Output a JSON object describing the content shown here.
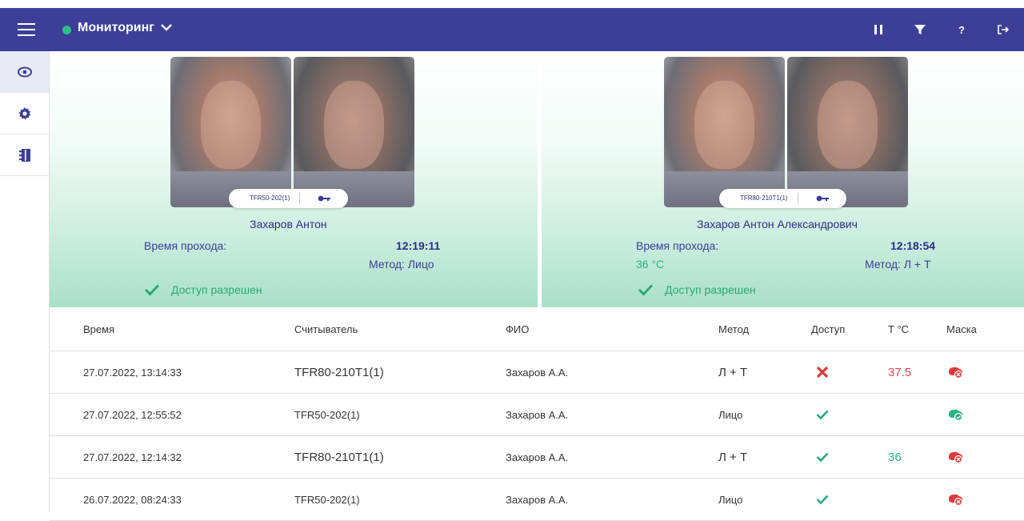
{
  "header": {
    "title": "Мониторинг",
    "status_color": "#2bbf86",
    "bg_color": "#3b3f98",
    "actions": [
      {
        "name": "pause-icon",
        "glyph": "II"
      },
      {
        "name": "filter-icon",
        "glyph": "▼"
      },
      {
        "name": "help-icon",
        "glyph": "?"
      },
      {
        "name": "logout-icon",
        "glyph": "↦"
      }
    ]
  },
  "sidebar": {
    "items": [
      {
        "name": "eye-icon",
        "active": true
      },
      {
        "name": "gear-icon",
        "active": false
      },
      {
        "name": "address-book-icon",
        "active": false
      }
    ]
  },
  "panels": [
    {
      "reader": "TFR50-202(1)",
      "person": "Захаров Антон",
      "time_label": "Время прохода:",
      "time": "12:19:11",
      "temperature": "",
      "method": "Метод: Лицо",
      "access": "Доступ разрешен"
    },
    {
      "reader": "TFR80-210T1(1)",
      "person": "Захаров Антон Александрович",
      "time_label": "Время прохода:",
      "time": "12:18:54",
      "temperature": "36 °C",
      "method": "Метод: Л + Т",
      "access": "Доступ разрешен"
    }
  ],
  "table": {
    "headers": {
      "time": "Время",
      "reader": "Считыватель",
      "fio": "ФИО",
      "method": "Метод",
      "access": "Доступ",
      "temp": "T °C",
      "mask": "Маска"
    },
    "rows": [
      {
        "time": "27.07.2022, 13:14:33",
        "reader": "TFR80-210T1(1)",
        "fio": "Захаров А.А.",
        "method": "Л + Т",
        "access": "denied",
        "temp": "37.5",
        "temp_status": "high",
        "mask": "no-mask"
      },
      {
        "time": "27.07.2022, 12:55:52",
        "reader": "TFR50-202(1)",
        "fio": "Захаров А.А.",
        "method": "Лицо",
        "access": "granted",
        "temp": "",
        "temp_status": "",
        "mask": "mask-ok"
      },
      {
        "time": "27.07.2022, 12:14:32",
        "reader": "TFR80-210T1(1)",
        "fio": "Захаров А.А.",
        "method": "Л + Т",
        "access": "granted",
        "temp": "36",
        "temp_status": "normal",
        "mask": "no-mask"
      },
      {
        "time": "26.07.2022, 08:24:33",
        "reader": "TFR50-202(1)",
        "fio": "Захаров А.А.",
        "method": "Лицо",
        "access": "granted",
        "temp": "",
        "temp_status": "",
        "mask": "no-mask"
      }
    ]
  }
}
